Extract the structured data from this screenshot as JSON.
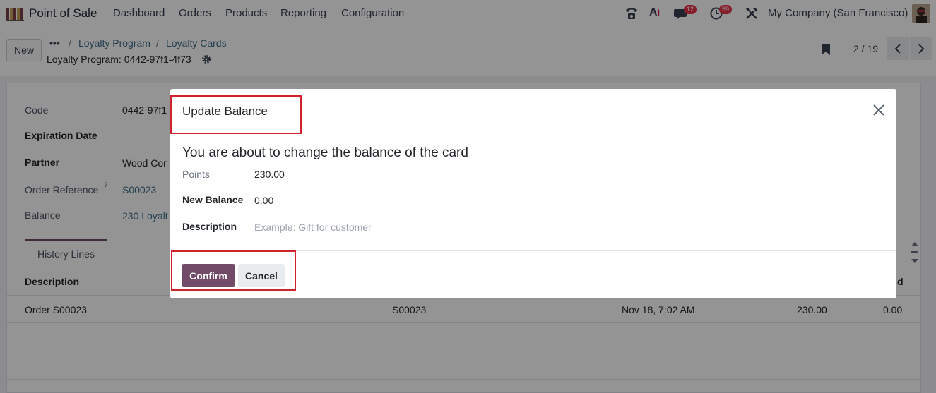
{
  "navbar": {
    "app_name": "Point of Sale",
    "menu": [
      "Dashboard",
      "Orders",
      "Products",
      "Reporting",
      "Configuration"
    ],
    "chat_badge": "12",
    "activity_badge": "59",
    "company": "My Company (San Francisco)",
    "icons": [
      "app-grid-icon",
      "phone-icon",
      "ai-icon",
      "chat-icon",
      "clock-icon",
      "tools-icon",
      "avatar"
    ]
  },
  "control_panel": {
    "new_label": "New",
    "more_label": "•••",
    "breadcrumbs": [
      "Loyalty Program",
      "Loyalty Cards"
    ],
    "record_title": "Loyalty Program: 0442-97f1-4f73",
    "pager": "2 / 19"
  },
  "form": {
    "code_label": "Code",
    "code_value": "0442-97f1",
    "expiration_label": "Expiration Date",
    "partner_label": "Partner",
    "partner_value": "Wood Cor",
    "order_ref_label": "Order Reference",
    "order_ref_help": "?",
    "order_ref_value": "S00023",
    "balance_label": "Balance",
    "balance_value": "230 Loyalt",
    "tab_label": "History Lines",
    "table": {
      "col_description": "Description",
      "col_last": "d",
      "rows": [
        {
          "description": "Order S00023",
          "order": "S00023",
          "date": "Nov 18, 7:02 AM",
          "issued": "230.00",
          "used": "0.00"
        }
      ]
    }
  },
  "dialog": {
    "title": "Update Balance",
    "heading": "You are about to change the balance of the card",
    "points_label": "Points",
    "points_value": "230.00",
    "new_balance_label": "New Balance",
    "new_balance_value": "0.00",
    "description_label": "Description",
    "description_placeholder": "Example: Gift for customer",
    "confirm_label": "Confirm",
    "cancel_label": "Cancel"
  },
  "colors": {
    "brand": "#714b67",
    "highlight": "#d0222c",
    "badge": "#e8364b",
    "link": "#3d6b87"
  }
}
